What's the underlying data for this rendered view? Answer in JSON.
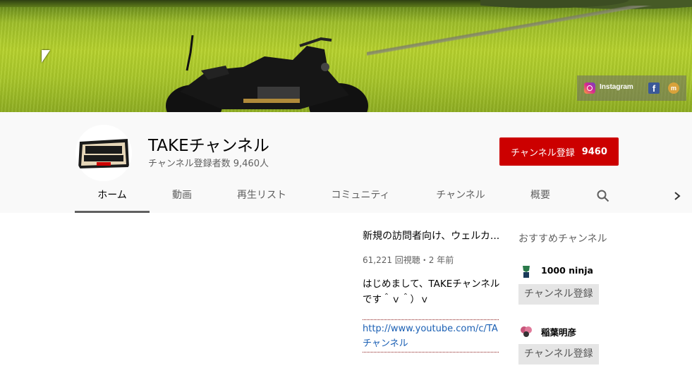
{
  "banner": {
    "social": {
      "instagram_label": "Instagram"
    }
  },
  "channel": {
    "name": "TAKEチャンネル",
    "subscribers_text": "チャンネル登録者数 9,460人",
    "subscribe_label": "チャンネル登録",
    "subscribe_count": "9460"
  },
  "tabs": [
    {
      "label": "ホーム",
      "active": true
    },
    {
      "label": "動画"
    },
    {
      "label": "再生リスト"
    },
    {
      "label": "コミュニティ"
    },
    {
      "label": "チャンネル"
    },
    {
      "label": "概要"
    }
  ],
  "featured": {
    "title": "新規の訪問者向け、ウェルカ...",
    "meta": "61,221 回視聴・2 年前",
    "description": "はじめまして、TAKEチャンネルです＾ｖ＾）ｖ",
    "link_line1": "http://www.youtube.com/c/TAKEチャンネル",
    "link_line2": "チャンネル"
  },
  "recommended": {
    "heading": "おすすめチャンネル",
    "items": [
      {
        "name": "1000 ninja",
        "button": "チャンネル登録"
      },
      {
        "name": "稲葉明彦",
        "button": "チャンネル登録"
      }
    ]
  }
}
